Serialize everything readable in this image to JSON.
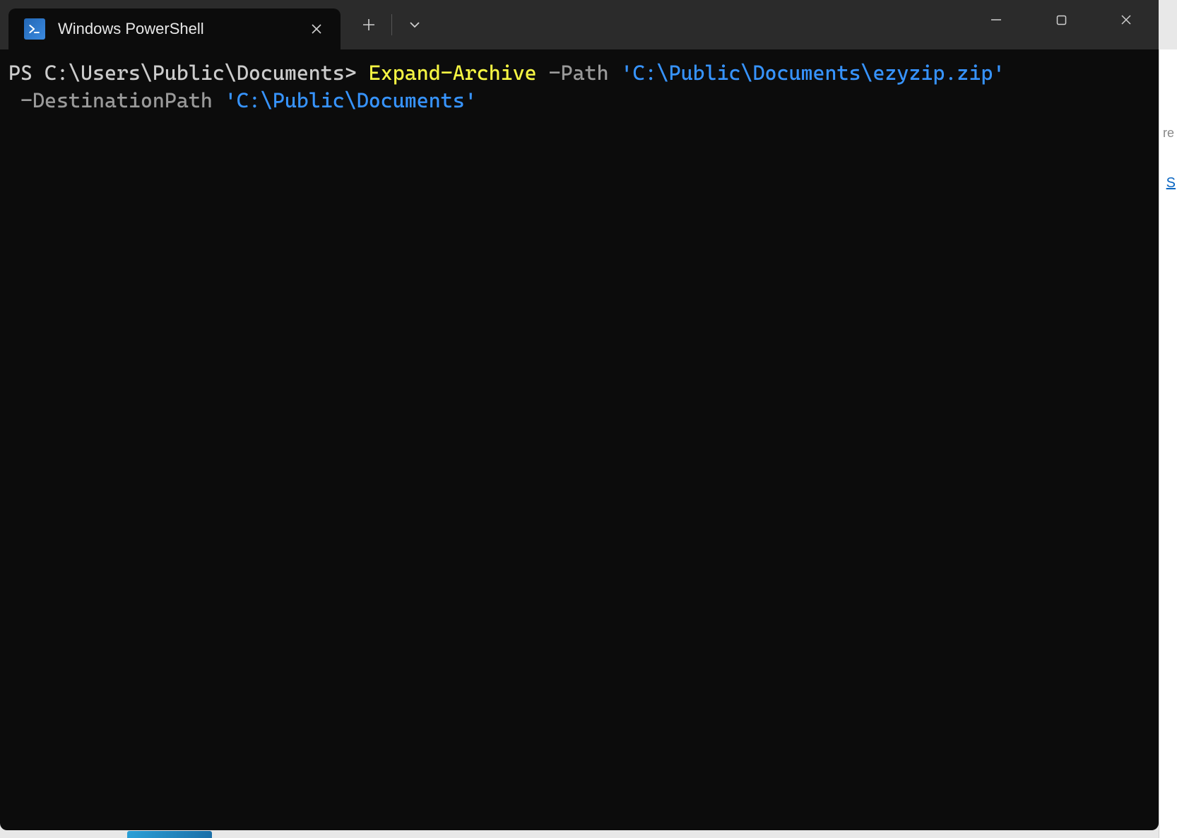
{
  "tab": {
    "title": "Windows PowerShell"
  },
  "terminal": {
    "line1": {
      "prompt": "PS C:\\Users\\Public\\Documents> ",
      "cmdlet": "Expand-Archive",
      "sp1": " ",
      "param1": "-Path",
      "sp2": " ",
      "string1": "'C:\\Public\\Documents\\ezyzip.zip'"
    },
    "line2": {
      "sp0": " ",
      "param2": "-DestinationPath",
      "sp3": " ",
      "string2": "'C:\\Public\\Documents'"
    }
  },
  "background": {
    "snippet1": "re",
    "snippet2": "S"
  }
}
